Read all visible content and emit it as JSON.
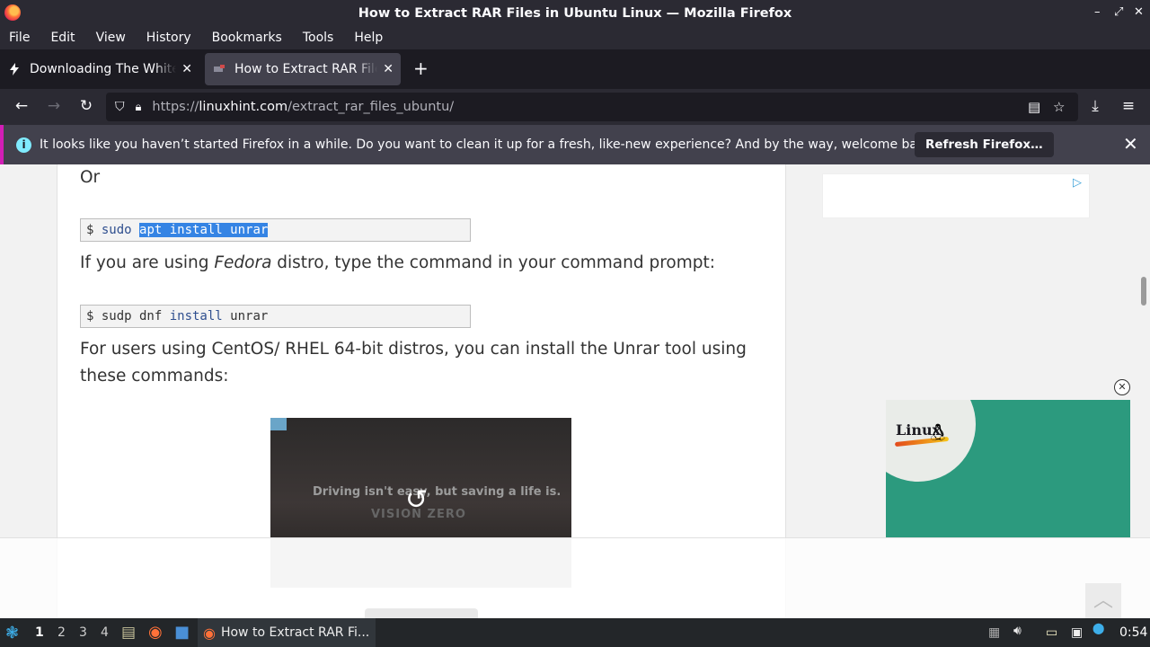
{
  "window": {
    "title": "How to Extract RAR Files in Ubuntu Linux — Mozilla Firefox",
    "controls": [
      "–",
      "⌃",
      "✕"
    ]
  },
  "menu": {
    "items": [
      "File",
      "Edit",
      "View",
      "History",
      "Bookmarks",
      "Tools",
      "Help"
    ]
  },
  "tabs": [
    {
      "label": "Downloading The White House",
      "icon": "bolt-icon",
      "active": false
    },
    {
      "label": "How to Extract RAR Files in Ubuntu Linux",
      "icon": "linuxhint-icon",
      "active": true
    }
  ],
  "nav": {
    "url_prefix": "https://",
    "url_domain": "linuxhint.com",
    "url_path": "/extract_rar_files_ubuntu/"
  },
  "notification": {
    "message": "It looks like you haven’t started Firefox in a while. Do you want to clean it up for a fresh, like-new experience? And by the way, welcome back!",
    "button_label": "Refresh Firefox…"
  },
  "article": {
    "or_text": "Or",
    "code1": {
      "prompt": "$ ",
      "cmd": "sudo ",
      "selected": "apt install unrar"
    },
    "fedora_before": "If you are using ",
    "fedora_em": "Fedora",
    "fedora_after": " distro, type the command in your command prompt:",
    "code2": {
      "prompt": "$ ",
      "cmd": "sudp dnf ",
      "kw": "install",
      "arg": " unrar"
    },
    "centos_line1": "For users using CentOS/ RHEL 64-bit distros, you can install the Unrar tool using",
    "centos_line2": "these commands:",
    "video_text": "Driving isn't easy, but saving a life is.",
    "video_brand": "VISION ZERO"
  },
  "ads": {
    "close_symbol": "✕",
    "linux_logo_text": "Linux"
  },
  "taskbar": {
    "workspaces": [
      "1",
      "2",
      "3",
      "4"
    ],
    "current_workspace": "1",
    "app_label": "How to Extract RAR Fi...",
    "clock": "0:54"
  }
}
